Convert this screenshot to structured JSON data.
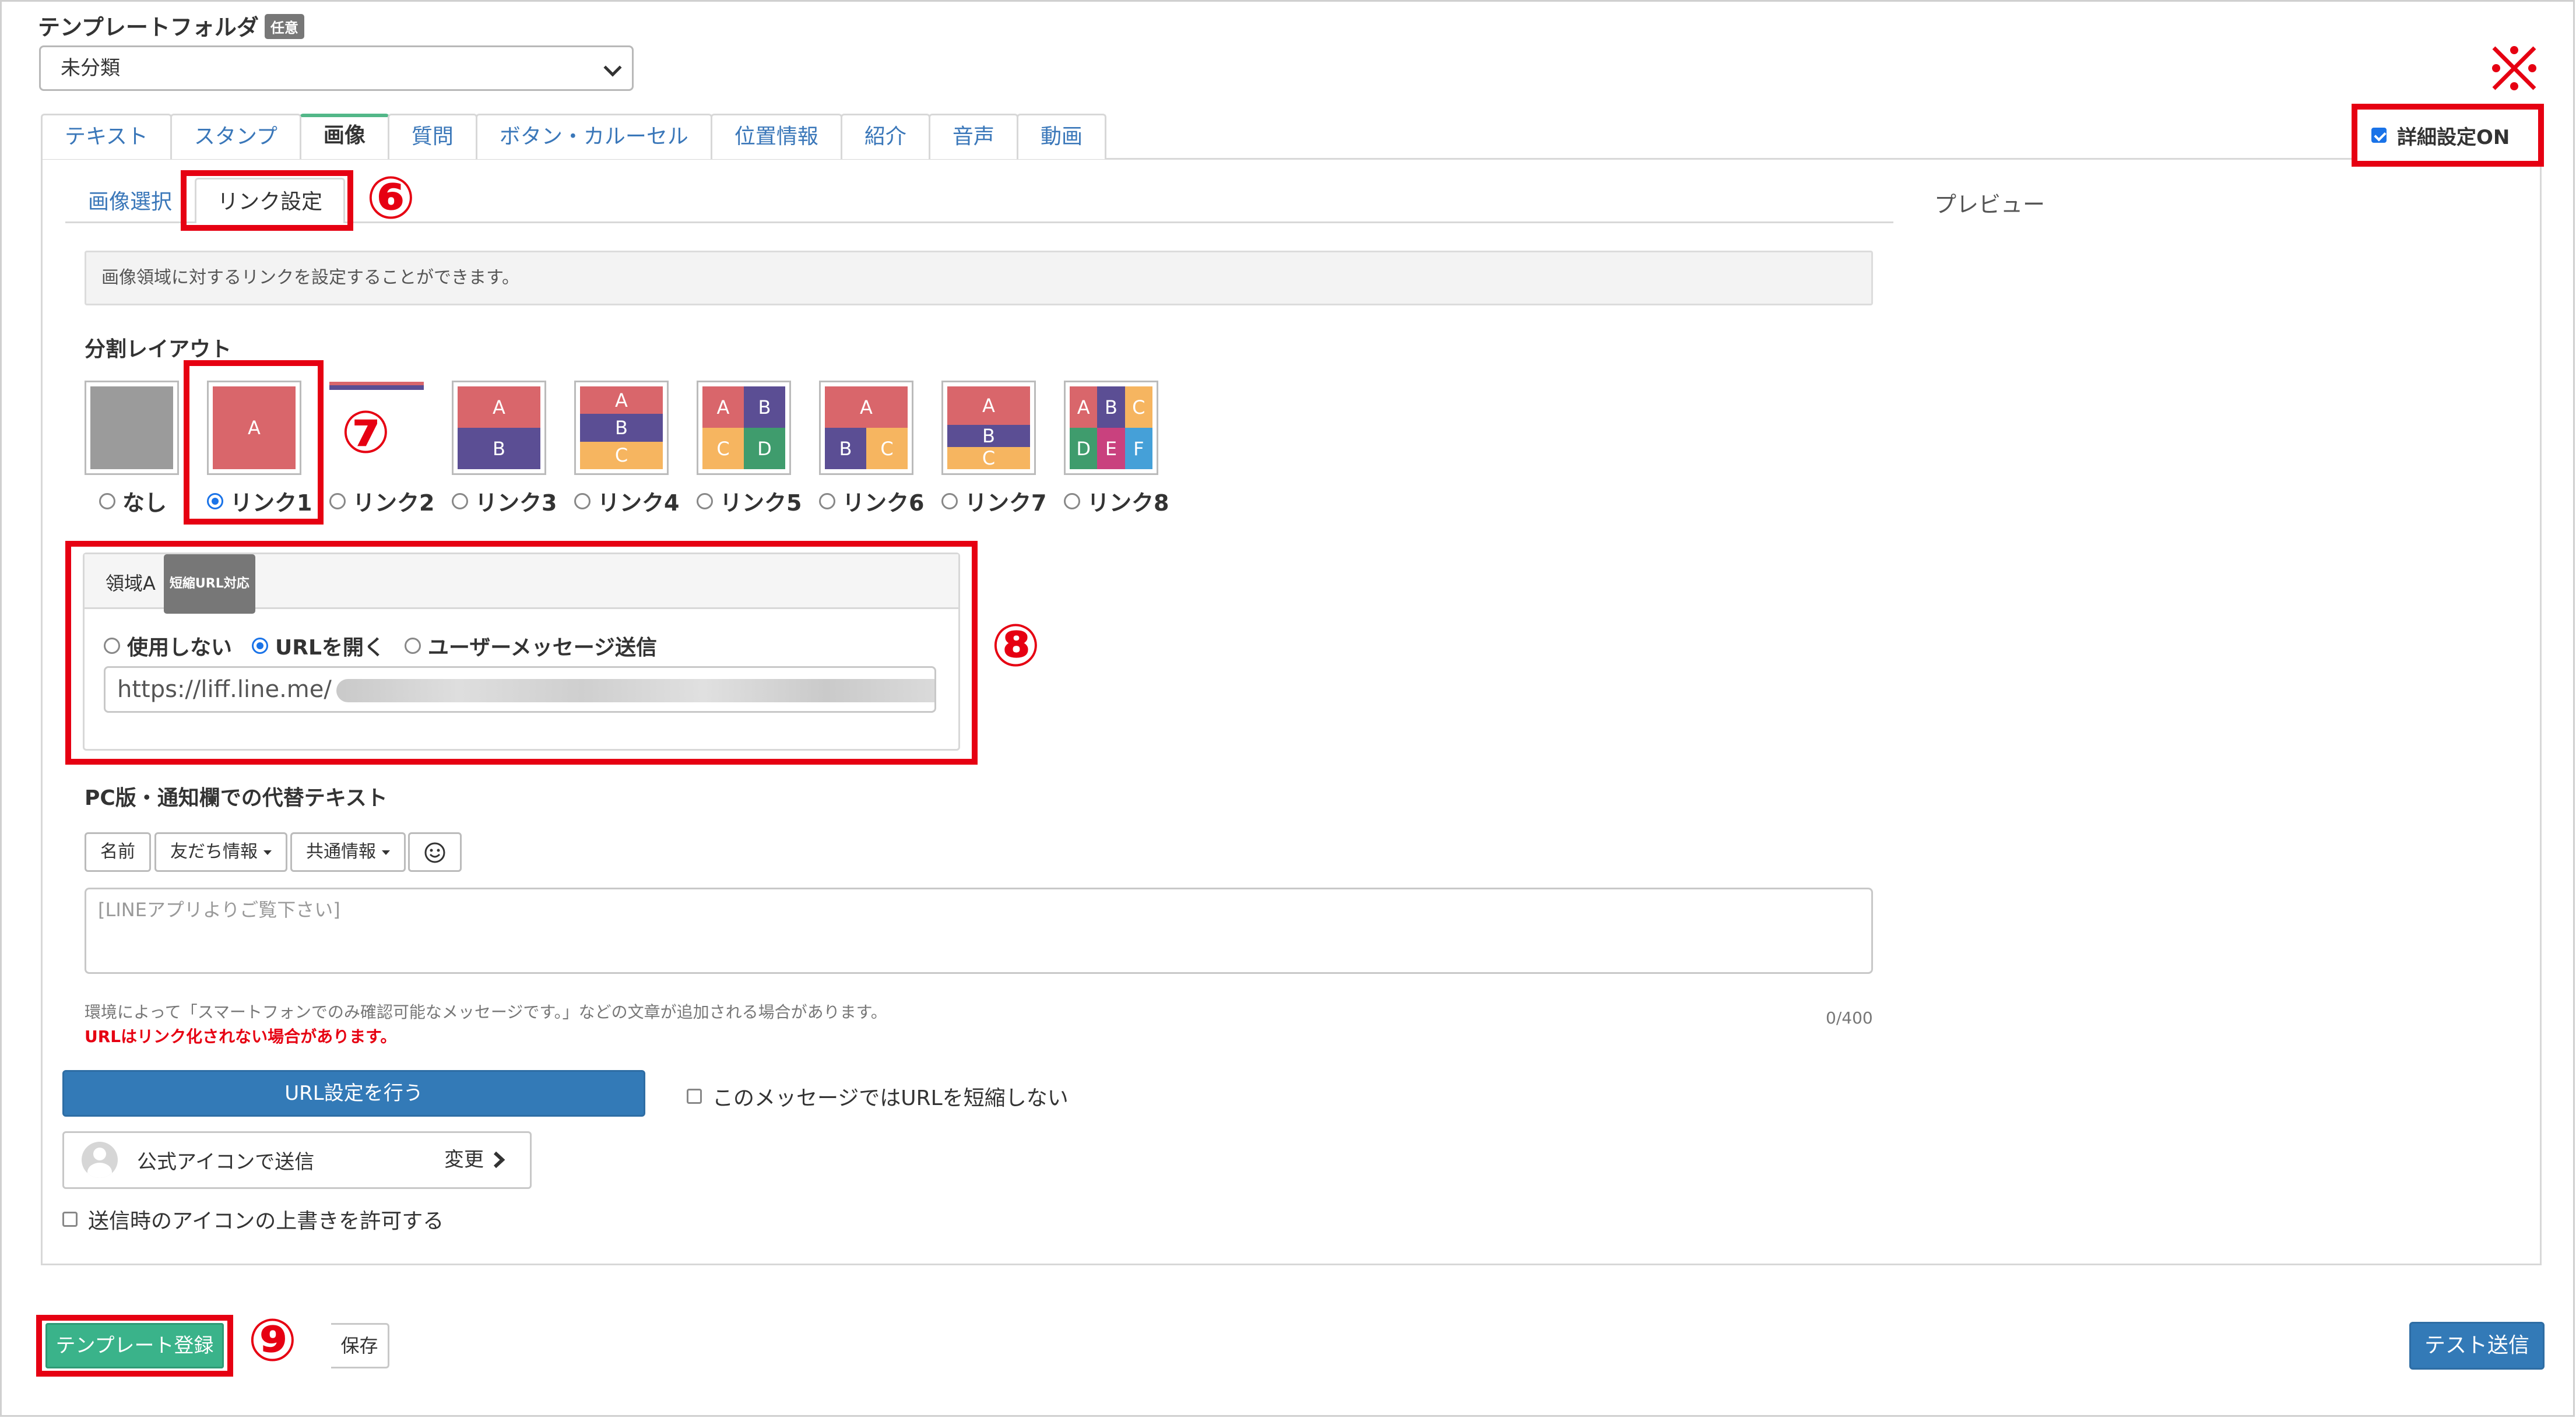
{
  "header": {
    "folder_label": "テンプレートフォルダ",
    "folder_badge": "任意",
    "folder_value": "未分類"
  },
  "tabs": [
    {
      "label": "テキスト"
    },
    {
      "label": "スタンプ"
    },
    {
      "label": "画像",
      "active": true
    },
    {
      "label": "質問"
    },
    {
      "label": "ボタン・カルーセル"
    },
    {
      "label": "位置情報"
    },
    {
      "label": "紹介"
    },
    {
      "label": "音声"
    },
    {
      "label": "動画"
    }
  ],
  "detail_toggle": {
    "label": "詳細設定ON",
    "checked": true
  },
  "subtabs": [
    {
      "label": "画像選択"
    },
    {
      "label": "リンク設定",
      "active": true
    }
  ],
  "preview_label": "プレビュー",
  "info_text": "画像領域に対するリンクを設定することができます。",
  "layout": {
    "label": "分割レイアウト",
    "options": [
      {
        "label": "なし",
        "cells": []
      },
      {
        "label": "リンク1",
        "cells": [
          "A"
        ],
        "selected": true
      },
      {
        "label": "リンク2",
        "cells": []
      },
      {
        "label": "リンク3",
        "cells": [
          "A",
          "B"
        ]
      },
      {
        "label": "リンク4",
        "cells": [
          "A",
          "B",
          "C"
        ]
      },
      {
        "label": "リンク5",
        "cells": [
          "A",
          "B",
          "C",
          "D"
        ]
      },
      {
        "label": "リンク6",
        "cells": [
          "A",
          "B",
          "C"
        ]
      },
      {
        "label": "リンク7",
        "cells": [
          "A",
          "B",
          "C"
        ]
      },
      {
        "label": "リンク8",
        "cells": [
          "A",
          "B",
          "C",
          "D",
          "E",
          "F"
        ]
      }
    ]
  },
  "region": {
    "title": "領域A",
    "badge": "短縮URL対応",
    "options": [
      {
        "label": "使用しない"
      },
      {
        "label": "URLを開く",
        "selected": true
      },
      {
        "label": "ユーザーメッセージ送信"
      }
    ],
    "url_value": "https://liff.line.me/"
  },
  "alt_text": {
    "label": "PC版・通知欄での代替テキスト",
    "buttons": [
      "名前",
      "友だち情報",
      "共通情報"
    ],
    "placeholder": "[LINEアプリよりご覧下さい]",
    "note": "環境によって「スマートフォンでのみ確認可能なメッセージです。」などの文章が追加される場合があります。",
    "warning": "URLはリンク化されない場合があります。",
    "counter": "0/400"
  },
  "url_settings_button": "URL設定を行う",
  "no_shorten_label": "このメッセージではURLを短縮しない",
  "sender": {
    "label": "公式アイコンで送信",
    "change": "変更"
  },
  "overwrite_label": "送信時のアイコンの上書きを許可する",
  "footer": {
    "register_button": "テンプレート登録",
    "save_button": "保存",
    "test_button": "テスト送信"
  },
  "annotations": {
    "n6": "⑥",
    "n7": "⑦",
    "n8": "⑧",
    "n9": "⑨"
  },
  "colors": {
    "highlight_red": "#e60012",
    "primary_blue": "#337ab7",
    "register_green": "#3ab38a",
    "cell_red": "#d9666b",
    "cell_purple": "#5b4e94",
    "cell_orange": "#f6b560",
    "cell_green": "#3f9c6d",
    "cell_pink": "#c9417e",
    "cell_blue": "#45a0d8",
    "none_gray": "#9b9b9b"
  }
}
